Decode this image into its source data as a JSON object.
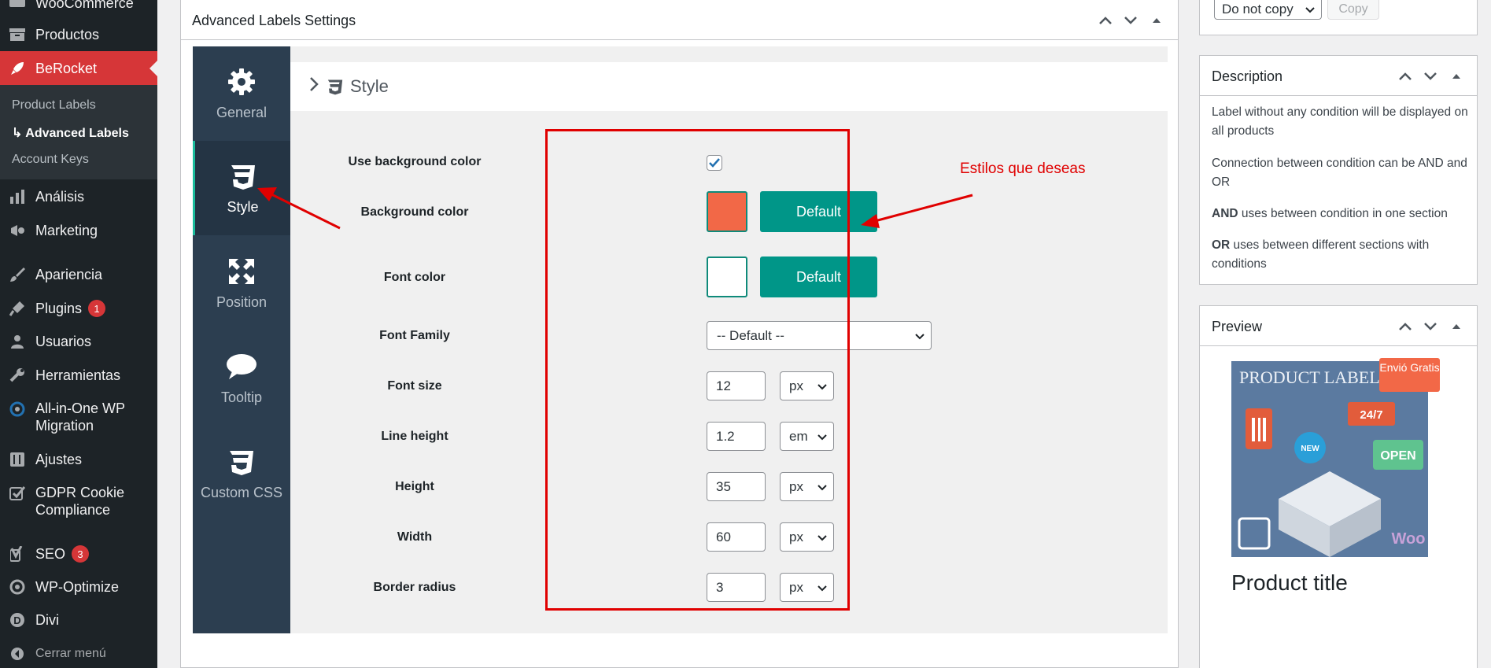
{
  "admin_menu": {
    "items": [
      {
        "label": "WooCommerce",
        "icon": "woocommerce-icon"
      },
      {
        "label": "Productos",
        "icon": "archive-icon"
      },
      {
        "label": "BeRocket",
        "icon": "rocket-icon"
      },
      {
        "label": "Análisis",
        "icon": "chart-bar-icon"
      },
      {
        "label": "Marketing",
        "icon": "megaphone-icon"
      },
      {
        "label": "Apariencia",
        "icon": "paintbrush-icon"
      },
      {
        "label": "Plugins",
        "icon": "plugin-icon",
        "badge": "1"
      },
      {
        "label": "Usuarios",
        "icon": "user-icon"
      },
      {
        "label": "Herramientas",
        "icon": "wrench-icon"
      },
      {
        "label": "All-in-One WP Migration",
        "icon": "migration-icon"
      },
      {
        "label": "Ajustes",
        "icon": "settings-sliders-icon"
      },
      {
        "label": "GDPR Cookie Compliance",
        "icon": "checkbox-icon"
      },
      {
        "label": "SEO",
        "icon": "yoast-icon",
        "badge": "3"
      },
      {
        "label": "WP-Optimize",
        "icon": "optimize-icon"
      },
      {
        "label": "Divi",
        "icon": "divi-icon"
      }
    ],
    "submenu": [
      "Product Labels",
      "Advanced Labels",
      "Account Keys"
    ],
    "collapse_label": "Cerrar menú"
  },
  "metabox": {
    "title": "Advanced Labels Settings"
  },
  "tabs": [
    {
      "label": "General",
      "icon": "gear-icon"
    },
    {
      "label": "Style",
      "icon": "css3-icon",
      "active": true
    },
    {
      "label": "Position",
      "icon": "move-arrows-icon"
    },
    {
      "label": "Tooltip",
      "icon": "speech-bubble-icon"
    },
    {
      "label": "Custom CSS",
      "icon": "css3-icon"
    }
  ],
  "section": {
    "title": "Style"
  },
  "style_options": {
    "use_bg_label": "Use background color",
    "use_bg_checked": true,
    "bg_label": "Background color",
    "bg_value": "#f26847",
    "font_color_label": "Font color",
    "font_color_value": "#ffffff",
    "default_button": "Default",
    "font_family_label": "Font Family",
    "font_family_value": "-- Default --",
    "font_size_label": "Font size",
    "font_size_value": "12",
    "font_size_unit": "px",
    "line_height_label": "Line height",
    "line_height_value": "1.2",
    "line_height_unit": "em",
    "height_label": "Height",
    "height_value": "35",
    "height_unit": "px",
    "width_label": "Width",
    "width_value": "60",
    "width_unit": "px",
    "border_radius_label": "Border radius",
    "border_radius_value": "3",
    "border_radius_unit": "px"
  },
  "annotation": "Estilos que deseas",
  "sidebar_top": {
    "select_value": "Do not copy",
    "copy_button": "Copy"
  },
  "description_box": {
    "title": "Description",
    "p1": "Label without any condition will be displayed on all products",
    "p2": "Connection between condition can be AND and OR",
    "p3_strong": "AND",
    "p3_rest": " uses between condition in one section",
    "p4_strong": "OR",
    "p4_rest": " uses between different sections with conditions"
  },
  "preview_box": {
    "title": "Preview",
    "image_text": "PRODUCT LABELS",
    "label_text": "Envió Gratis",
    "product_title": "Product title"
  },
  "colors": {
    "accent_teal": "#009688",
    "wp_red": "#d63638",
    "annotation_red": "#e00000",
    "tabs_bg": "#2c3e50"
  }
}
